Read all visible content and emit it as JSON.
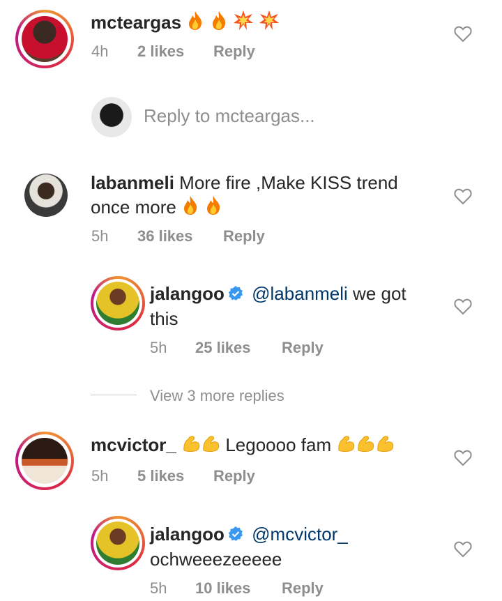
{
  "comments": [
    {
      "username": "mcteargas",
      "text": "",
      "emojis": [
        "fire-emoji",
        "fire-emoji",
        "collision-emoji",
        "collision-emoji"
      ],
      "time": "4h",
      "likes": "2 likes",
      "reply": "Reply"
    },
    {
      "username": "labanmeli",
      "text_line1": "More fire ,Make KISS trend",
      "text_line2": "once more",
      "emojis": [
        "fire-emoji",
        "fire-emoji"
      ],
      "time": "5h",
      "likes": "36 likes",
      "reply": "Reply"
    },
    {
      "username": "mcvictor_",
      "text": "Legoooo fam",
      "emojis_before": [
        "flexed-biceps-emoji",
        "flexed-biceps-emoji"
      ],
      "emojis_after": [
        "flexed-biceps-emoji",
        "flexed-biceps-emoji",
        "flexed-biceps-emoji"
      ],
      "time": "5h",
      "likes": "5 likes",
      "reply": "Reply"
    }
  ],
  "reply_box": {
    "placeholder": "Reply to mcteargas..."
  },
  "replies": [
    {
      "username": "jalangoo",
      "verified": true,
      "mention": "@labanmeli",
      "text_rest": " we got",
      "text_line2": "this",
      "time": "5h",
      "likes": "25 likes",
      "reply": "Reply"
    },
    {
      "username": "jalangoo",
      "verified": true,
      "mention": "@mcvictor_",
      "text_line2": "ochweeezeeeee",
      "time": "5h",
      "likes": "10 likes",
      "reply": "Reply"
    }
  ],
  "view_more": "View 3 more replies",
  "colors": {
    "text": "#262626",
    "meta": "#8e8e8e",
    "mention": "#00376b",
    "verified": "#3897f0",
    "heart": "#8e8e8e"
  }
}
